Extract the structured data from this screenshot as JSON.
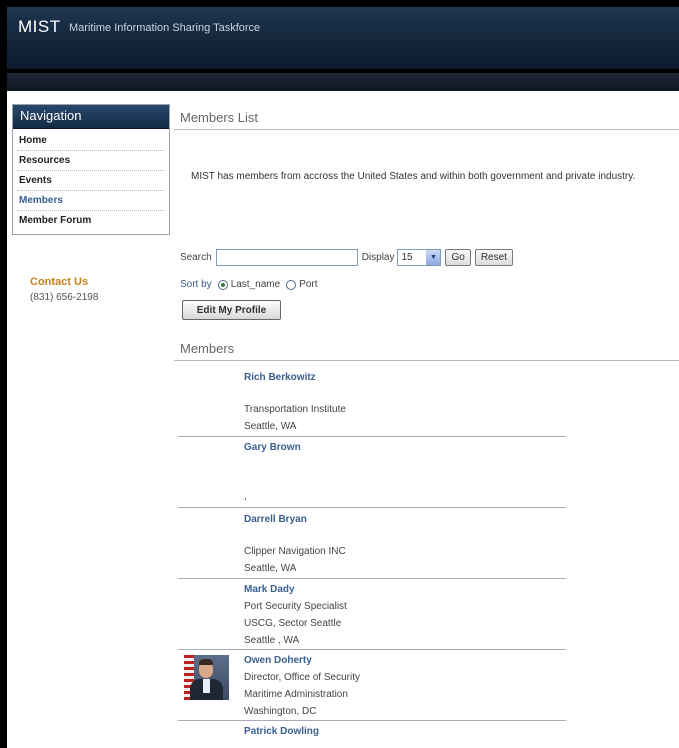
{
  "header": {
    "logo": "MIST",
    "tagline": "Maritime Information Sharing Taskforce"
  },
  "nav": {
    "title": "Navigation",
    "items": [
      {
        "label": "Home"
      },
      {
        "label": "Resources"
      },
      {
        "label": "Events"
      },
      {
        "label": "Members"
      },
      {
        "label": "Member Forum"
      }
    ]
  },
  "contact": {
    "title": "Contact Us",
    "phone": "(831) 656-2198"
  },
  "main": {
    "title": "Members List",
    "intro": "MIST has members from accross the United States and within both government and private industry."
  },
  "search": {
    "label": "Search",
    "value": "",
    "display_label": "Display",
    "display_value": "15",
    "go_label": "Go",
    "reset_label": "Reset"
  },
  "sort": {
    "label": "Sort by",
    "options": [
      "Last_name",
      "Port"
    ],
    "selected": "Last_name"
  },
  "edit_profile_label": "Edit My Profile",
  "members_title": "Members",
  "members": [
    {
      "name": "Rich Berkowitz",
      "title": "",
      "org": "Transportation Institute",
      "location": "Seattle, WA"
    },
    {
      "name": "Gary Brown",
      "title": "",
      "org": "",
      "location": ","
    },
    {
      "name": "Darrell Bryan",
      "title": "",
      "org": "Clipper Navigation INC",
      "location": "Seattle, WA"
    },
    {
      "name": "Mark Dady",
      "title": "Port Security Specialist",
      "org": "USCG, Sector Seattle",
      "location": "Seattle , WA"
    },
    {
      "name": "Owen Doherty",
      "title": "Director, Office of Security",
      "org": "Maritime Administration",
      "location": "Washington, DC"
    },
    {
      "name": "Patrick Dowling",
      "title": "",
      "org": "",
      "location": ""
    }
  ],
  "colors": {
    "header_bg": "#15283e",
    "link": "#3a5f8f",
    "contact": "#c7801e"
  }
}
